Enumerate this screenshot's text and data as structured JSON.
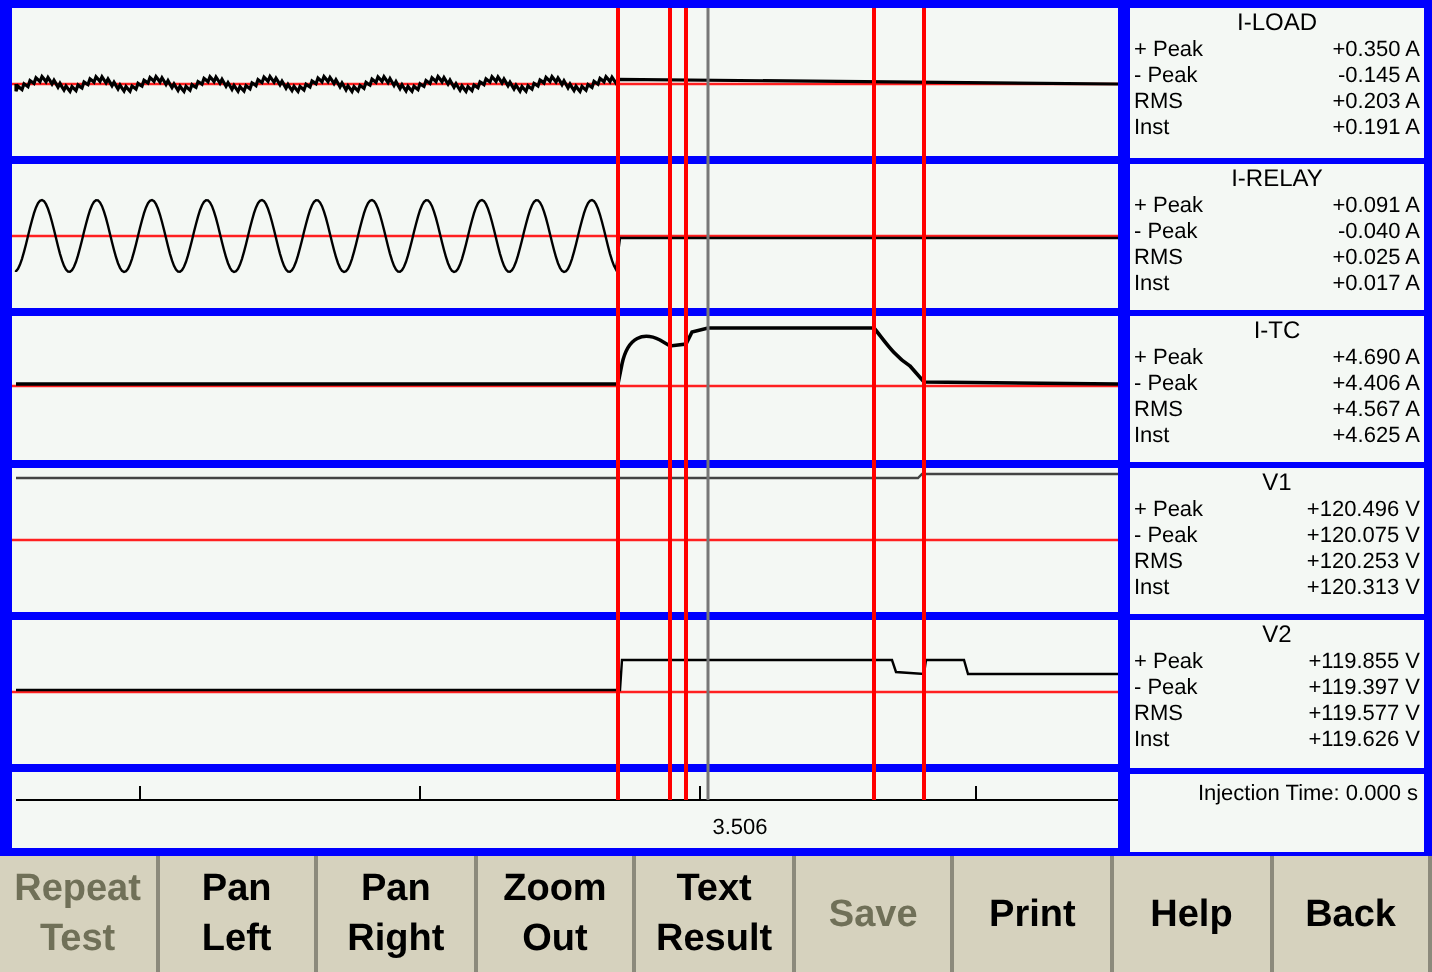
{
  "channels": [
    {
      "name": "I-LOAD",
      "readings": [
        {
          "label": "+ Peak",
          "value": "+0.350 A"
        },
        {
          "label": "- Peak",
          "value": "-0.145 A"
        },
        {
          "label": "RMS",
          "value": "+0.203 A"
        },
        {
          "label": "Inst",
          "value": "+0.191 A"
        }
      ]
    },
    {
      "name": "I-RELAY",
      "readings": [
        {
          "label": "+ Peak",
          "value": "+0.091 A"
        },
        {
          "label": "- Peak",
          "value": "-0.040 A"
        },
        {
          "label": "RMS",
          "value": "+0.025 A"
        },
        {
          "label": "Inst",
          "value": "+0.017 A"
        }
      ]
    },
    {
      "name": "I-TC",
      "readings": [
        {
          "label": "+ Peak",
          "value": "+4.690 A"
        },
        {
          "label": "- Peak",
          "value": "+4.406 A"
        },
        {
          "label": "RMS",
          "value": "+4.567 A"
        },
        {
          "label": "Inst",
          "value": "+4.625 A"
        }
      ]
    },
    {
      "name": "V1",
      "readings": [
        {
          "label": "+ Peak",
          "value": "+120.496 V"
        },
        {
          "label": "- Peak",
          "value": "+120.075 V"
        },
        {
          "label": "RMS",
          "value": "+120.253 V"
        },
        {
          "label": "Inst",
          "value": "+120.313 V"
        }
      ]
    },
    {
      "name": "V2",
      "readings": [
        {
          "label": "+ Peak",
          "value": "+119.855 V"
        },
        {
          "label": "- Peak",
          "value": "+119.397 V"
        },
        {
          "label": "RMS",
          "value": "+119.577 V"
        },
        {
          "label": "Inst",
          "value": "+119.626 V"
        }
      ]
    }
  ],
  "axis_label": "3.506",
  "injection_time": "Injection Time: 0.000 s",
  "buttons": [
    {
      "label": "Repeat\nTest",
      "disabled": true
    },
    {
      "label": "Pan\nLeft",
      "disabled": false
    },
    {
      "label": "Pan\nRight",
      "disabled": false
    },
    {
      "label": "Zoom\nOut",
      "disabled": false
    },
    {
      "label": "Text\nResult",
      "disabled": false
    },
    {
      "label": "Save",
      "disabled": true
    },
    {
      "label": "Print",
      "disabled": false
    },
    {
      "label": "Help",
      "disabled": false
    },
    {
      "label": "Back",
      "disabled": false
    }
  ]
}
